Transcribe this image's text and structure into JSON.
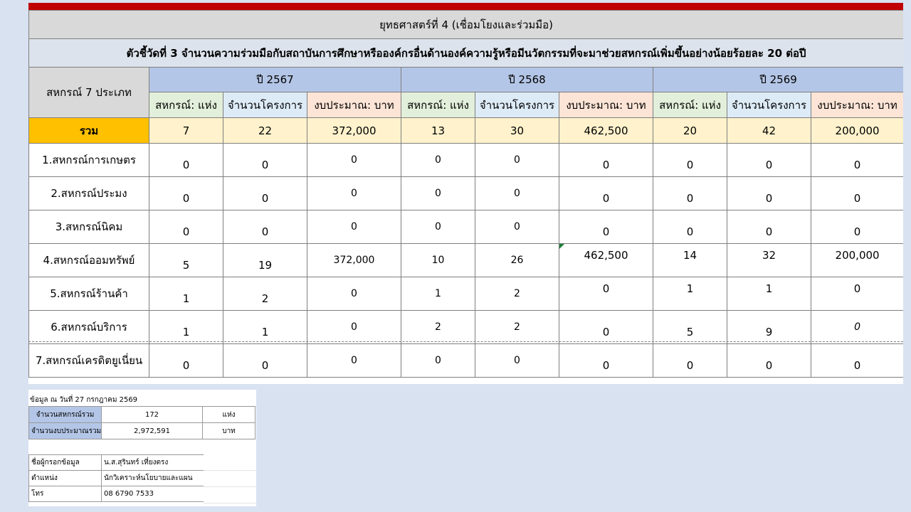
{
  "title": "ยุทธศาสตร์ที่ 4 (เชื่อมโยงและร่วมมือ)",
  "indicator": "ตัวชี้วัดที่ 3 จำนวนความร่วมมือกับสถาบันการศึกษาหรือองค์กรอื่นด้านองค์ความรู้หรือมีนวัตกรรมที่จะมาช่วยสหกรณ์เพิ่มขึ้นอย่างน้อยร้อยละ 20 ต่อปี",
  "category_header": "สหกรณ์ 7 ประเภท",
  "years": [
    "ปี 2567",
    "ปี 2568",
    "ปี 2569"
  ],
  "col_headers": [
    "สหกรณ์: แห่ง",
    "จำนวนโครงการ",
    "งบประมาณ: บาท"
  ],
  "total": {
    "label": "รวม",
    "values": [
      "7",
      "22",
      "372,000",
      "13",
      "30",
      "462,500",
      "20",
      "42",
      "200,000"
    ]
  },
  "rows": [
    {
      "label": "1.สหกรณ์การเกษตร",
      "values": [
        "0",
        "0",
        "0",
        "0",
        "0",
        "0",
        "0",
        "0",
        "0"
      ]
    },
    {
      "label": "2.สหกรณ์ประมง",
      "values": [
        "0",
        "0",
        "0",
        "0",
        "0",
        "0",
        "0",
        "0",
        "0"
      ]
    },
    {
      "label": "3.สหกรณ์นิคม",
      "values": [
        "0",
        "0",
        "0",
        "0",
        "0",
        "0",
        "0",
        "0",
        "0"
      ]
    },
    {
      "label": "4.สหกรณ์ออมทรัพย์",
      "values": [
        "5",
        "19",
        "372,000",
        "10",
        "26",
        "462,500",
        "14",
        "32",
        "200,000"
      ]
    },
    {
      "label": "5.สหกรณ์ร้านค้า",
      "values": [
        "1",
        "2",
        "0",
        "1",
        "2",
        "0",
        "1",
        "1",
        "0"
      ]
    },
    {
      "label": "6.สหกรณ์บริการ",
      "values": [
        "1",
        "1",
        "0",
        "2",
        "2",
        "0",
        "5",
        "9",
        "0"
      ]
    },
    {
      "label": "7.สหกรณ์เครดิตยูเนี่ยน",
      "values": [
        "0",
        "0",
        "0",
        "0",
        "0",
        "0",
        "0",
        "0",
        "0"
      ]
    }
  ],
  "info": {
    "date": "ข้อมูล ณ วันที่  27 กรกฎาคม 2569",
    "summary": [
      {
        "label": "จำนวนสหกรณ์รวม",
        "value": "172",
        "unit": "แห่ง"
      },
      {
        "label": "จำนวนงบประมาณรวม",
        "value": "2,972,591",
        "unit": "บาท"
      }
    ],
    "contact": [
      {
        "label": "ชื่อผู้กรอกข้อมูล",
        "value": "น.ส.สุรินทร์ เที่ยงตรง"
      },
      {
        "label": "ตำแหน่ง",
        "value": "นักวิเคราะห์นโยบายและแผน"
      },
      {
        "label": "โทร",
        "value": "08 6790 7533"
      }
    ]
  },
  "colors": {
    "accent_bar": "#c00000",
    "total_label": "#ffc000",
    "total_row": "#fff2cc",
    "year_header": "#b4c6e7"
  }
}
